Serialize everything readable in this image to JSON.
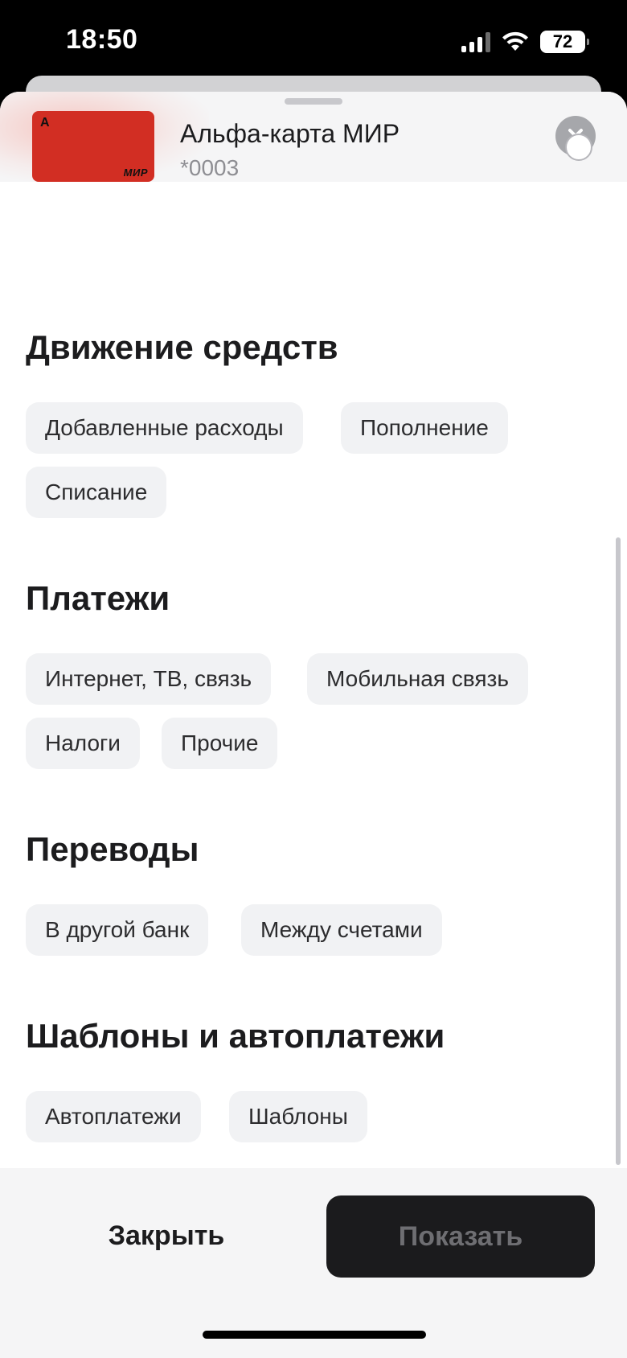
{
  "status_bar": {
    "time": "18:50",
    "battery": "72",
    "icons": [
      "signal-icon",
      "wifi-icon",
      "battery-icon"
    ]
  },
  "sheet": {
    "close_icon": "close-icon"
  },
  "card": {
    "title": "Альфа-карта МИР",
    "number": "*0003",
    "logo_letter": "А",
    "brand": "МИР",
    "color": "#d22e23"
  },
  "sections": [
    {
      "title": "Движение средств",
      "chips": [
        "Добавленные расходы",
        "Пополнение",
        "Списание"
      ]
    },
    {
      "title": "Платежи",
      "chips": [
        "Интернет, ТВ, связь",
        "Мобильная связь",
        "Налоги",
        "Прочие"
      ]
    },
    {
      "title": "Переводы",
      "chips": [
        "В другой банк",
        "Между счетами"
      ]
    },
    {
      "title": "Шаблоны и автоплатежи",
      "chips": [
        "Автоплатежи",
        "Шаблоны"
      ]
    }
  ],
  "footer": {
    "close_label": "Закрыть",
    "show_label": "Показать"
  }
}
